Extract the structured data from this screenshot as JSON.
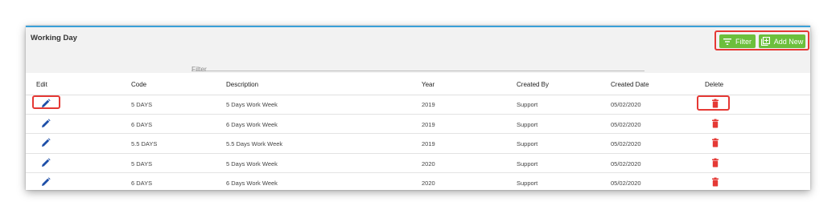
{
  "page": {
    "title": "Working Day",
    "filter_button": "Filter",
    "add_button": "Add New",
    "filter_placeholder": "Filter"
  },
  "columns": [
    "Edit",
    "Code",
    "Description",
    "Year",
    "Created By",
    "Created Date",
    "Delete"
  ],
  "rows": [
    {
      "code": "5 DAYS",
      "description": "5 Days Work Week",
      "year": "2019",
      "created_by": "Support",
      "created_date": "05/02/2020"
    },
    {
      "code": "6 DAYS",
      "description": "6 Days Work Week",
      "year": "2019",
      "created_by": "Support",
      "created_date": "05/02/2020"
    },
    {
      "code": "5.5 DAYS",
      "description": "5.5 Days Work Week",
      "year": "2019",
      "created_by": "Support",
      "created_date": "05/02/2020"
    },
    {
      "code": "5 DAYS",
      "description": "5 Days Work Week",
      "year": "2020",
      "created_by": "Support",
      "created_date": "05/02/2020"
    },
    {
      "code": "6 DAYS",
      "description": "6 Days Work Week",
      "year": "2020",
      "created_by": "Support",
      "created_date": "05/02/2020"
    }
  ],
  "icons": {
    "edit": "pencil-icon",
    "delete": "trash-icon",
    "filter": "filter-lines-icon",
    "add": "add-box-icon"
  },
  "colors": {
    "button_green": "#6cbf3c",
    "edit_blue": "#1e4fa8",
    "delete_red": "#e53935",
    "highlight_red": "#e53935",
    "accent_blue": "#3aa0d8"
  }
}
